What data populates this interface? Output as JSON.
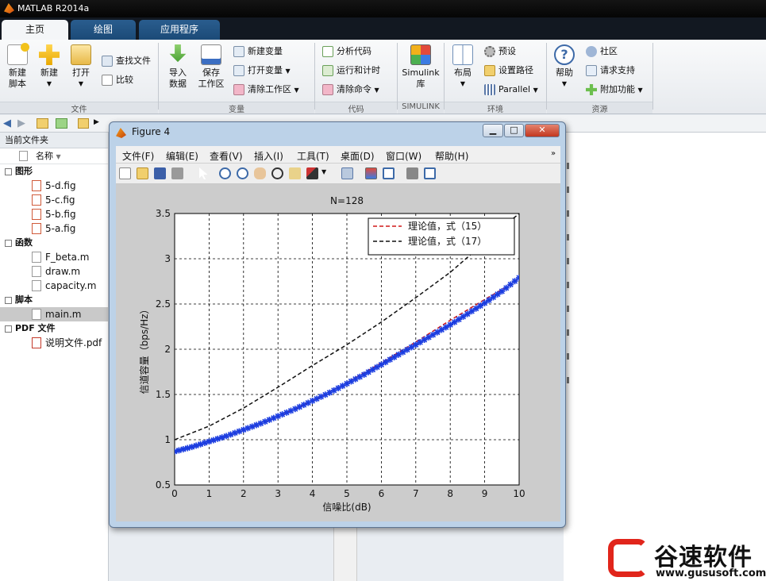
{
  "app": {
    "title": "MATLAB R2014a"
  },
  "tabs": [
    "主页",
    "绘图",
    "应用程序"
  ],
  "ribbon": {
    "groups": [
      "文件",
      "变量",
      "代码",
      "SIMULINK",
      "环境",
      "资源"
    ],
    "file": {
      "new_script": "新建\n脚本",
      "new": "新建",
      "open": "打开",
      "find_files": "查找文件",
      "compare": "比较"
    },
    "variable": {
      "import_data": "导入\n数据",
      "save_workspace": "保存\n工作区",
      "new_variable": "新建变量",
      "open_variable": "打开变量",
      "clear_workspace": "清除工作区"
    },
    "code": {
      "analyze": "分析代码",
      "run_time": "运行和计时",
      "clear_commands": "清除命令"
    },
    "simulink": {
      "library": "Simulink\n库"
    },
    "env": {
      "layout": "布局",
      "preferences": "预设",
      "set_path": "设置路径",
      "parallel": "Parallel"
    },
    "resources": {
      "help": "帮助",
      "community": "社区",
      "request_support": "请求支持",
      "addons": "附加功能"
    }
  },
  "current_folder": {
    "header": "当前文件夹",
    "col_name": "名称",
    "groups": [
      {
        "label": "图形",
        "files": [
          "5-d.fig",
          "5-c.fig",
          "5-b.fig",
          "5-a.fig"
        ]
      },
      {
        "label": "函数",
        "files": [
          "F_beta.m",
          "draw.m",
          "capacity.m"
        ]
      },
      {
        "label": "脚本",
        "files": [
          "main.m"
        ]
      },
      {
        "label": "PDF 文件",
        "files": [
          "说明文件.pdf"
        ]
      }
    ],
    "selected": "main.m"
  },
  "figure": {
    "title": "Figure 4",
    "menu": [
      "文件(F)",
      "编辑(E)",
      "查看(V)",
      "插入(I)",
      "工具(T)",
      "桌面(D)",
      "窗口(W)",
      "帮助(H)"
    ]
  },
  "chart_data": {
    "type": "line",
    "title": "N=128",
    "xlabel": "信噪比(dB)",
    "ylabel": "信道容量（bps/Hz）",
    "xlim": [
      0,
      10
    ],
    "ylim": [
      0.5,
      3.5
    ],
    "xticks": [
      0,
      1,
      2,
      3,
      4,
      5,
      6,
      7,
      8,
      9,
      10
    ],
    "yticks": [
      0.5,
      1,
      1.5,
      2,
      2.5,
      3,
      3.5
    ],
    "grid": true,
    "legend_position": "top-right",
    "series": [
      {
        "name": "理论值，式（15）",
        "style": "dashed",
        "color": "#d01818",
        "x": [
          0,
          1,
          2,
          3,
          4,
          5,
          6,
          7,
          8,
          9,
          10
        ],
        "y": [
          0.86,
          0.97,
          1.1,
          1.25,
          1.43,
          1.63,
          1.85,
          2.08,
          2.32,
          2.55,
          2.77
        ]
      },
      {
        "name": "理论值，式（17）",
        "style": "dashed",
        "color": "#111111",
        "x": [
          0,
          1,
          2,
          3,
          4,
          5,
          6,
          7,
          8,
          9,
          10
        ],
        "y": [
          1.0,
          1.15,
          1.35,
          1.58,
          1.82,
          2.05,
          2.3,
          2.57,
          2.85,
          3.18,
          3.5
        ]
      },
      {
        "name": "",
        "style": "markers",
        "color": "#1a3ce0",
        "x": [
          0,
          0.5,
          1,
          1.5,
          2,
          2.5,
          3,
          3.5,
          4,
          4.5,
          5,
          5.5,
          6,
          6.5,
          7,
          7.5,
          8,
          8.5,
          9,
          9.5,
          10
        ],
        "y": [
          0.87,
          0.92,
          0.98,
          1.04,
          1.11,
          1.18,
          1.26,
          1.34,
          1.43,
          1.52,
          1.62,
          1.72,
          1.83,
          1.94,
          2.05,
          2.16,
          2.27,
          2.39,
          2.51,
          2.64,
          2.79
        ]
      }
    ]
  },
  "watermark": {
    "brand": "谷速软件",
    "url": "www.gususoft.com"
  },
  "colors": {
    "accent": "#1b4a77",
    "figure_frame": "#bcd2e8"
  }
}
